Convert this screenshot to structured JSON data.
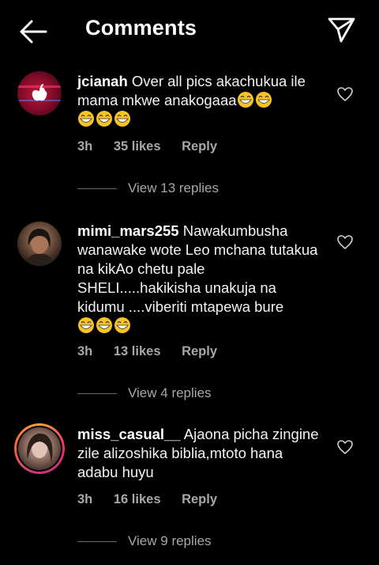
{
  "header": {
    "title": "Comments",
    "back_icon": "arrow-left-icon",
    "share_icon": "send-icon"
  },
  "comments": [
    {
      "username": "jcianah",
      "text": "Over all pics akachukua ile mama mkwe anakogaaa",
      "emoji": "😁😁😁😁😁",
      "time": "3h",
      "likes": "35 likes",
      "reply": "Reply",
      "view_replies": "View 13 replies"
    },
    {
      "username": "mimi_mars255",
      "text": "Nawakumbusha wanawake wote Leo mchana tutakua na kikAo chetu pale SHELI.....hakikisha unakuja na kidumu ....viberiti mtapewa bure",
      "emoji": "😁😁😁",
      "time": "3h",
      "likes": "13 likes",
      "reply": "Reply",
      "view_replies": "View 4 replies"
    },
    {
      "username": "miss_casual__",
      "text": "Ajaona picha zingine zile alizoshika biblia,mtoto hana adabu huyu",
      "time": "3h",
      "likes": "16 likes",
      "reply": "Reply",
      "view_replies": "View 9 replies"
    }
  ]
}
